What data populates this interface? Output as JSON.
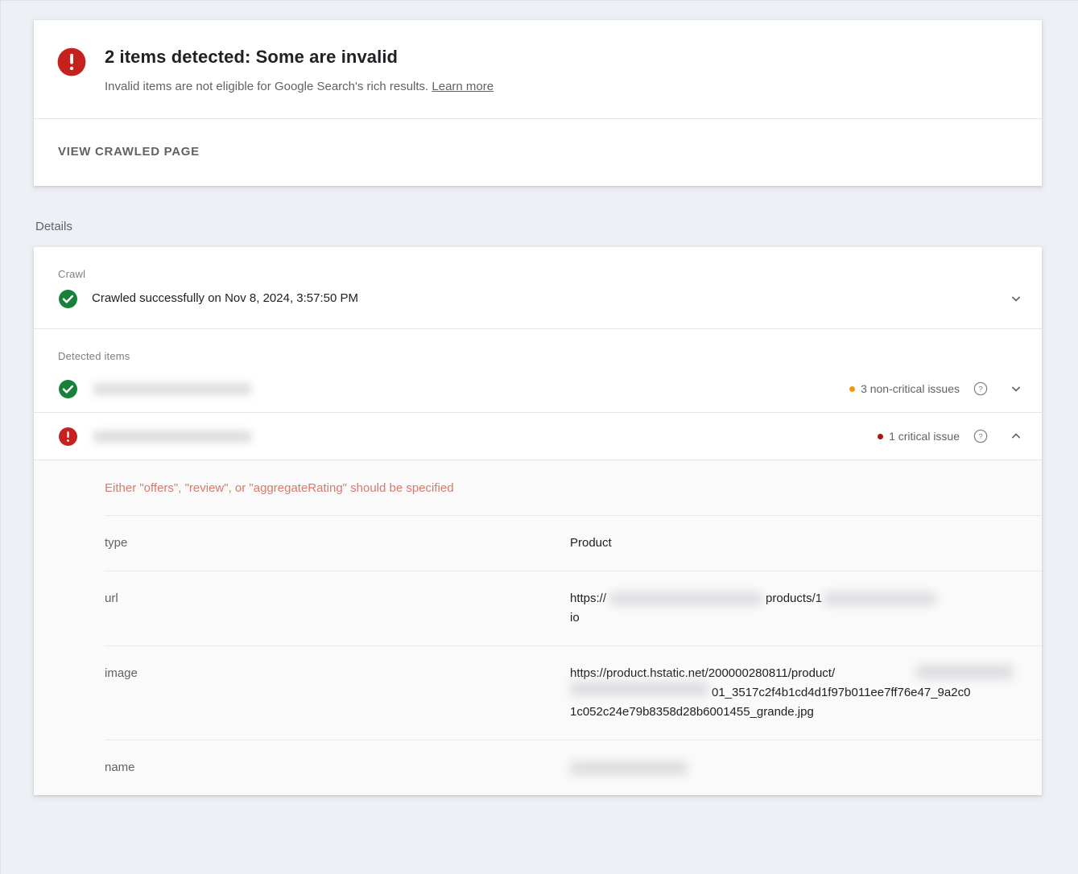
{
  "summary": {
    "status_icon": "error-circle-icon",
    "title": "2 items detected: Some are invalid",
    "subtitle": "Invalid items are not eligible for Google Search's rich results.",
    "learn_more_label": "Learn more",
    "view_crawled_page_label": "VIEW CRAWLED PAGE"
  },
  "details": {
    "section_label": "Details",
    "crawl": {
      "label": "Crawl",
      "status_icon": "success-check-icon",
      "status_text": "Crawled successfully on Nov 8, 2024, 3:57:50 PM",
      "expand_icon": "chevron-down-icon"
    },
    "detected_items": {
      "label": "Detected items",
      "items": [
        {
          "status_icon": "success-check-icon",
          "name": "",
          "name_redacted": true,
          "issue_text": "3 non-critical issues",
          "issue_dot_color": "#f29900",
          "help_icon": "help-circle-icon",
          "expand_icon": "chevron-down-icon",
          "expanded": false
        },
        {
          "status_icon": "error-circle-icon",
          "name": "",
          "name_redacted": true,
          "issue_text": "1 critical issue",
          "issue_dot_color": "#b31412",
          "help_icon": "help-circle-icon",
          "expand_icon": "chevron-up-icon",
          "expanded": true,
          "error_message": "Either \"offers\", \"review\", or \"aggregateRating\" should be specified",
          "properties": [
            {
              "key": "type",
              "value": "Product",
              "redacted": false
            },
            {
              "key": "url",
              "value_parts": [
                "https://",
                "products/1",
                "io"
              ],
              "redacted": true
            },
            {
              "key": "image",
              "value": "https://product.hstatic.net/200000280811/product/",
              "value_line2": "01_3517c2f4b1cd4d1f97b011ee7ff76e47_9a2c0",
              "value_line3": "1c052c24e79b8358d28b6001455_grande.jpg",
              "redacted": true
            },
            {
              "key": "name",
              "value": "",
              "redacted": true
            }
          ]
        }
      ]
    }
  },
  "colors": {
    "error_red": "#c5221f",
    "success_green": "#188038",
    "warning_orange": "#f29900",
    "critical_dark_red": "#b31412",
    "error_text": "#d9796b",
    "page_bg": "#edf0f4",
    "card_bg": "#ffffff",
    "panel_bg": "#fafafa"
  }
}
